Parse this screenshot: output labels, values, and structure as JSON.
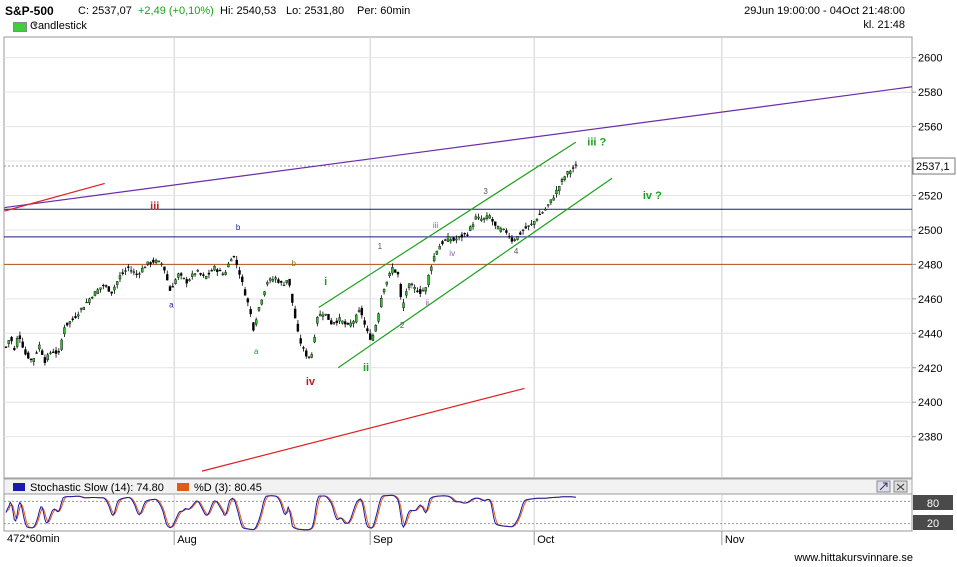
{
  "header": {
    "symbol": "S&P-500",
    "close": "C: 2537,07",
    "change": "+2,49 (+0,10%)",
    "high": "Hi: 2540,53",
    "low": "Lo: 2531,80",
    "period": "Per: 60min",
    "range": "29Jun 19:00:00 - 04Oct 21:48:00",
    "time": "kl. 21:48",
    "chart_type": "Candlestick",
    "chart_type_color": "#3cd03c",
    "chevron_icon": "chevron-down-icon"
  },
  "indicator": {
    "stoch_label": "Stochastic Slow (14): 74.80",
    "stoch_color": "#1a1aa8",
    "d_label": "%D (3): 80.45",
    "d_color": "#e05a1a",
    "level_80": "80",
    "level_20": "20"
  },
  "footer": {
    "bars": "472*60min",
    "site": "www.hittakursvinnare.se"
  },
  "chart_data": {
    "type": "candlestick",
    "x_tick_labels": [
      "Aug",
      "Sep",
      "Oct",
      "Nov"
    ],
    "x_tick_positions_bars": [
      121,
      262,
      380,
      515
    ],
    "y_ticks": [
      2380,
      2400,
      2420,
      2440,
      2460,
      2480,
      2500,
      2520,
      2540,
      2560,
      2580,
      2600
    ],
    "ylim": [
      2356,
      2612
    ],
    "last_price_label": "2537,1",
    "last_price": 2537.1,
    "horizontal_lines": [
      {
        "value": 2512,
        "color": "#1a1a7a"
      },
      {
        "value": 2496,
        "color": "#1a1a7a"
      },
      {
        "value": 2480,
        "color": "#b0501a"
      }
    ],
    "trend_lines": [
      {
        "color": "#6a2ca8",
        "from": [
          -1,
          2513
        ],
        "to": [
          660,
          2584
        ]
      },
      {
        "color": "#e02020",
        "from": [
          -1,
          2511
        ],
        "to": [
          71,
          2527
        ]
      },
      {
        "color": "#e02020",
        "from": [
          141,
          2360
        ],
        "to": [
          373,
          2408
        ]
      },
      {
        "color": "#1aa31a",
        "from": [
          225,
          2455
        ],
        "to": [
          410,
          2551
        ]
      },
      {
        "color": "#1aa31a",
        "from": [
          239,
          2420
        ],
        "to": [
          436,
          2530
        ]
      }
    ],
    "price_path": [
      [
        0,
        2432
      ],
      [
        3,
        2438
      ],
      [
        6,
        2430
      ],
      [
        9,
        2440
      ],
      [
        14,
        2428
      ],
      [
        19,
        2424
      ],
      [
        24,
        2433
      ],
      [
        28,
        2424
      ],
      [
        33,
        2430
      ],
      [
        38,
        2428
      ],
      [
        42,
        2444
      ],
      [
        48,
        2448
      ],
      [
        55,
        2455
      ],
      [
        62,
        2462
      ],
      [
        70,
        2468
      ],
      [
        76,
        2464
      ],
      [
        82,
        2473
      ],
      [
        88,
        2478
      ],
      [
        94,
        2474
      ],
      [
        101,
        2480
      ],
      [
        107,
        2482
      ],
      [
        113,
        2480
      ],
      [
        118,
        2465
      ],
      [
        124,
        2474
      ],
      [
        130,
        2470
      ],
      [
        137,
        2476
      ],
      [
        143,
        2472
      ],
      [
        150,
        2478
      ],
      [
        157,
        2474
      ],
      [
        163,
        2486
      ],
      [
        167,
        2478
      ],
      [
        171,
        2466
      ],
      [
        175,
        2455
      ],
      [
        178,
        2443
      ],
      [
        183,
        2458
      ],
      [
        188,
        2470
      ],
      [
        194,
        2472
      ],
      [
        199,
        2468
      ],
      [
        203,
        2472
      ],
      [
        206,
        2458
      ],
      [
        210,
        2440
      ],
      [
        213,
        2432
      ],
      [
        217,
        2426
      ],
      [
        220,
        2428
      ],
      [
        224,
        2450
      ],
      [
        229,
        2452
      ],
      [
        234,
        2446
      ],
      [
        240,
        2448
      ],
      [
        246,
        2444
      ],
      [
        251,
        2448
      ],
      [
        255,
        2454
      ],
      [
        259,
        2442
      ],
      [
        263,
        2436
      ],
      [
        267,
        2448
      ],
      [
        271,
        2465
      ],
      [
        275,
        2472
      ],
      [
        278,
        2478
      ],
      [
        282,
        2474
      ],
      [
        285,
        2454
      ],
      [
        289,
        2468
      ],
      [
        294,
        2466
      ],
      [
        298,
        2464
      ],
      [
        302,
        2466
      ],
      [
        305,
        2477
      ],
      [
        309,
        2487
      ],
      [
        313,
        2492
      ],
      [
        318,
        2495
      ],
      [
        322,
        2494
      ],
      [
        327,
        2496
      ],
      [
        332,
        2498
      ],
      [
        338,
        2507
      ],
      [
        343,
        2506
      ],
      [
        348,
        2508
      ],
      [
        352,
        2502
      ],
      [
        356,
        2500
      ],
      [
        360,
        2499
      ],
      [
        364,
        2494
      ],
      [
        368,
        2496
      ],
      [
        372,
        2500
      ],
      [
        378,
        2503
      ],
      [
        383,
        2508
      ],
      [
        388,
        2512
      ],
      [
        393,
        2518
      ],
      [
        397,
        2524
      ],
      [
        401,
        2530
      ],
      [
        405,
        2534
      ],
      [
        410,
        2537
      ]
    ],
    "wave_labels": [
      {
        "text": "iii",
        "bar": 107,
        "y": 2512,
        "color": "#c21a1a",
        "size": 11,
        "bold": true
      },
      {
        "text": "b",
        "bar": 167,
        "y": 2500,
        "color": "#1a1aa8",
        "size": 8,
        "bold": false
      },
      {
        "text": "a",
        "bar": 119,
        "y": 2455,
        "color": "#1a1aa8",
        "size": 8,
        "bold": false
      },
      {
        "text": "b",
        "bar": 207,
        "y": 2479,
        "color": "#8a7a1a",
        "size": 8,
        "bold": false
      },
      {
        "text": "a",
        "bar": 180,
        "y": 2428,
        "color": "#1aa31a",
        "size": 8,
        "bold": false
      },
      {
        "text": "iv",
        "bar": 219,
        "y": 2410,
        "color": "#c21a1a",
        "size": 11,
        "bold": true
      },
      {
        "text": "i",
        "bar": 230,
        "y": 2468,
        "color": "#1aa31a",
        "size": 11,
        "bold": true
      },
      {
        "text": "ii",
        "bar": 259,
        "y": 2418,
        "color": "#1aa31a",
        "size": 11,
        "bold": true
      },
      {
        "text": "1",
        "bar": 269,
        "y": 2489,
        "color": "#555555",
        "size": 8,
        "bold": false
      },
      {
        "text": "2",
        "bar": 285,
        "y": 2443,
        "color": "#555555",
        "size": 8,
        "bold": false
      },
      {
        "text": "i",
        "bar": 292,
        "y": 2466,
        "color": "#8a5aa8",
        "size": 8,
        "bold": false
      },
      {
        "text": "ii",
        "bar": 303,
        "y": 2456,
        "color": "#8a5aa8",
        "size": 8,
        "bold": false
      },
      {
        "text": "iii",
        "bar": 309,
        "y": 2501,
        "color": "#8a5aa8",
        "size": 8,
        "bold": false
      },
      {
        "text": "iv",
        "bar": 321,
        "y": 2485,
        "color": "#8a5aa8",
        "size": 8,
        "bold": false
      },
      {
        "text": "3",
        "bar": 345,
        "y": 2521,
        "color": "#555555",
        "size": 8,
        "bold": false
      },
      {
        "text": "4",
        "bar": 367,
        "y": 2486,
        "color": "#555555",
        "size": 8,
        "bold": false
      },
      {
        "text": "iii ?",
        "bar": 425,
        "y": 2549,
        "color": "#1aa31a",
        "size": 11,
        "bold": true
      },
      {
        "text": "iv ?",
        "bar": 465,
        "y": 2518,
        "color": "#1aa31a",
        "size": 11,
        "bold": true
      }
    ],
    "stochastic": {
      "levels": [
        80,
        20
      ],
      "last_k": 74.8,
      "last_d": 80.45
    }
  }
}
